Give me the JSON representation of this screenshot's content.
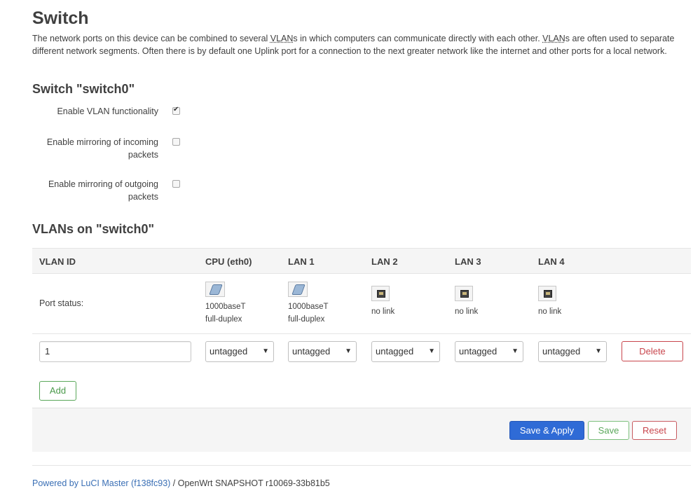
{
  "page": {
    "title": "Switch",
    "description_parts": [
      "The network ports on this device can be combined to several ",
      "VLAN",
      "s in which computers can communicate directly with each other. ",
      "VLAN",
      "s are often used to separate different network segments. Often there is by default one Uplink port for a connection to the next greater network like the internet and other ports for a local network."
    ]
  },
  "switch_section": {
    "heading": "Switch \"switch0\"",
    "options": [
      {
        "label": "Enable VLAN functionality",
        "checked": true
      },
      {
        "label": "Enable mirroring of incoming packets",
        "checked": false
      },
      {
        "label": "Enable mirroring of outgoing packets",
        "checked": false
      }
    ]
  },
  "vlans_section": {
    "heading": "VLANs on \"switch0\"",
    "columns": [
      "VLAN ID",
      "CPU (eth0)",
      "LAN 1",
      "LAN 2",
      "LAN 3",
      "LAN 4"
    ],
    "port_status_label": "Port status:",
    "ports": [
      {
        "icon": "cable-connected-icon",
        "line1": "1000baseT",
        "line2": "full-duplex"
      },
      {
        "icon": "cable-connected-icon",
        "line1": "1000baseT",
        "line2": "full-duplex"
      },
      {
        "icon": "port-nolink-icon",
        "line1": "no link",
        "line2": ""
      },
      {
        "icon": "port-nolink-icon",
        "line1": "no link",
        "line2": ""
      },
      {
        "icon": "port-nolink-icon",
        "line1": "no link",
        "line2": ""
      }
    ],
    "row": {
      "vlan_id": "1",
      "selects": [
        "untagged",
        "untagged",
        "untagged",
        "untagged",
        "untagged"
      ],
      "delete_label": "Delete"
    },
    "add_label": "Add"
  },
  "actions": {
    "save_apply_label": "Save & Apply",
    "save_label": "Save",
    "reset_label": "Reset"
  },
  "footer": {
    "link_text": "Powered by LuCI Master (f138fc93)",
    "version_text": " / OpenWrt SNAPSHOT r10069-33b81b5"
  },
  "colors": {
    "primary": "#2f6bd6",
    "positive": "#5aa75a",
    "negative": "#c8454c",
    "link": "#3a6fb5"
  }
}
